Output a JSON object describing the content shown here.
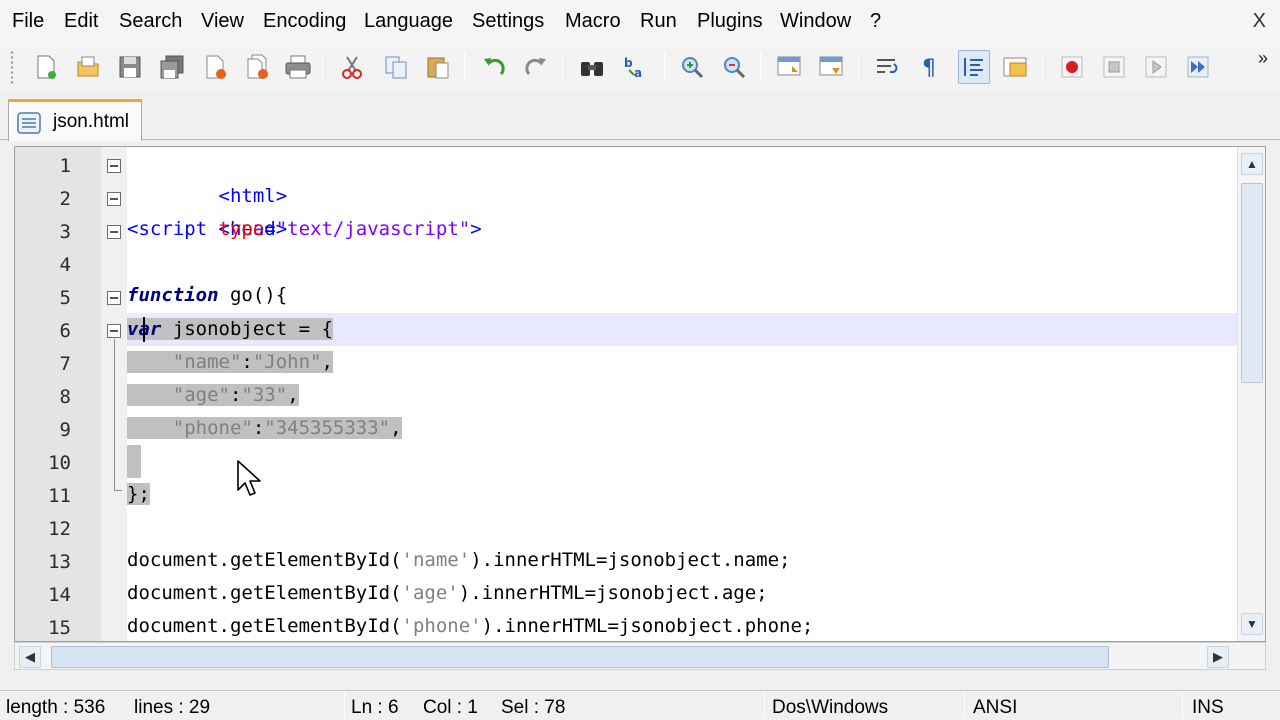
{
  "menu": {
    "items": [
      "File",
      "Edit",
      "Search",
      "View",
      "Encoding",
      "Language",
      "Settings",
      "Macro",
      "Run",
      "Plugins",
      "Window",
      "?"
    ],
    "close": "X"
  },
  "toolbar": {
    "more": "»",
    "buttons": [
      "new-file-icon",
      "open-file-icon",
      "save-icon",
      "save-all-icon",
      "close-icon",
      "close-all-icon",
      "print-icon",
      "cut-icon",
      "copy-icon",
      "paste-icon",
      "undo-icon",
      "redo-icon",
      "find-icon",
      "replace-icon",
      "zoom-in-icon",
      "zoom-out-icon",
      "sync-vertical-icon",
      "sync-horizontal-icon",
      "word-wrap-icon",
      "show-all-chars-icon",
      "indent-guide-icon",
      "user-lang-icon",
      "record-macro-icon",
      "stop-record-icon",
      "playback-icon",
      "run-macro-multiple-icon"
    ]
  },
  "tab": {
    "label": "json.html"
  },
  "editor": {
    "lines": [
      {
        "num": "1"
      },
      {
        "num": "2"
      },
      {
        "num": "3"
      },
      {
        "num": "4"
      },
      {
        "num": "5"
      },
      {
        "num": "6"
      },
      {
        "num": "7"
      },
      {
        "num": "8"
      },
      {
        "num": "9"
      },
      {
        "num": "10"
      },
      {
        "num": "11"
      },
      {
        "num": "12"
      },
      {
        "num": "13"
      },
      {
        "num": "14"
      },
      {
        "num": "15"
      }
    ],
    "code": {
      "l1": "<html>",
      "l2": "<head>",
      "l3_tag": "<script ",
      "l3_attr": "type",
      "l3_eq": "=",
      "l3_str": "\"text/javascript\"",
      "l3_end": ">",
      "l5_kw": "function",
      "l5_rest": " go(){",
      "l6_kw": "var",
      "l6_rest": " jsonobject = {",
      "l7_indent": "    ",
      "l7_k": "\"name\"",
      "l7_c": ":",
      "l7_v": "\"John\"",
      "l7_e": ",",
      "l8_k": "\"age\"",
      "l8_c": ":",
      "l8_v": "\"33\"",
      "l8_e": ",",
      "l9_k": "\"phone\"",
      "l9_c": ":",
      "l9_v": "\"345355333\"",
      "l9_e": ",",
      "l11": "};",
      "l13_a": "document.getElementById(",
      "l13_s": "'name'",
      "l13_b": ").innerHTML=jsonobject.name;",
      "l14_a": "document.getElementById(",
      "l14_s": "'age'",
      "l14_b": ").innerHTML=jsonobject.age;",
      "l15_a": "document.getElementById(",
      "l15_s": "'phone'",
      "l15_b": ").innerHTML=jsonobject.phone;"
    }
  },
  "status": {
    "length": "length : 536",
    "lines": "lines : 29",
    "ln": "Ln : 6",
    "col": "Col : 1",
    "sel": "Sel : 78",
    "eol": "Dos\\Windows",
    "encoding": "ANSI",
    "mode": "INS"
  }
}
